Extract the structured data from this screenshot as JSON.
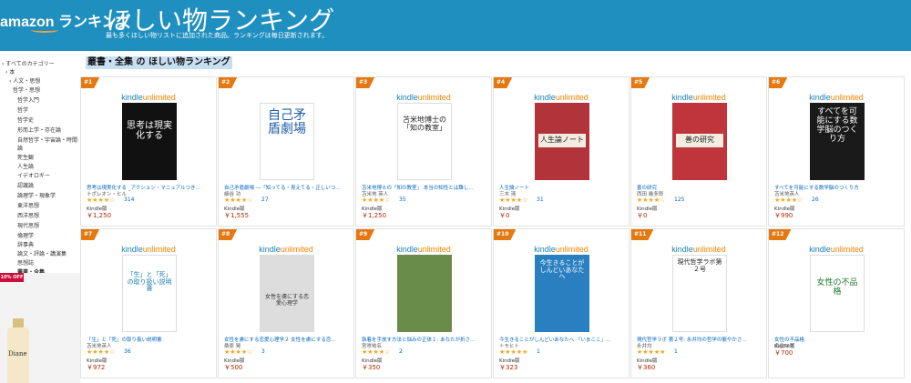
{
  "header": {
    "logo": "amazon ランキング",
    "title": "ほしい物ランキング",
    "subtitle": "最も多くほしい物リストに追加された商品。ランキングは毎日更新されます。"
  },
  "sidebar": {
    "items": [
      "‹ すべてのカテゴリー",
      "‹ 本",
      "‹ 人文・思想",
      "哲学・思想",
      "哲学入門",
      "哲学",
      "哲学史",
      "形而上学・存在論",
      "自然哲学・宇宙論・時間論",
      "死生観",
      "人生論",
      "イデオロギー",
      "認識論",
      "論理学・現象学",
      "東洋思想",
      "西洋思想",
      "現代思想",
      "倫理学",
      "辞事典",
      "論文・評論・講演集",
      "思想誌",
      "叢書・全集"
    ],
    "promo_badge": "10% OFF",
    "promo_label": "Diane"
  },
  "section_title": "叢書・全集 の ほしい物ランキング",
  "kindle_unlimited": {
    "kindle": "kindle",
    "unlimited": "unlimited"
  },
  "colors": {
    "header": "#1f8fbf",
    "rank": "#e47911",
    "star": "#f4a41d",
    "price": "#b12704",
    "link": "#0066c0"
  },
  "products": [
    {
      "rank": "#1",
      "ku": true,
      "cover_text": "思考は現実化する",
      "title": "思考は現実化する _アクション・マニュアルつき…",
      "author": "ナポレオン・ヒル",
      "stars": "★★★★☆",
      "reviews": "314",
      "format": "Kindle版",
      "price": "￥1,250"
    },
    {
      "rank": "#2",
      "ku": false,
      "cover_text": "自己矛盾劇場",
      "title": "自己矛盾劇場 ―「知ってる・見えてる・正しいつ…",
      "author": "細谷 功",
      "stars": "★★★★☆",
      "reviews": "27",
      "format": "Kindle版",
      "price": "￥1,555"
    },
    {
      "rank": "#3",
      "ku": true,
      "cover_text": "苫米地博士の「知の教室」",
      "title": "苫米地博士の「知の教室」 本当の知性とは難し…",
      "author": "苫米地 英人",
      "stars": "★★★★☆",
      "reviews": "35",
      "format": "Kindle版",
      "price": "￥1,250"
    },
    {
      "rank": "#4",
      "ku": true,
      "cover_text": "人生論ノート",
      "title": "人生論ノート",
      "author": "三木 清",
      "stars": "★★★★☆",
      "reviews": "31",
      "format": "Kindle版",
      "price": "￥0"
    },
    {
      "rank": "#5",
      "ku": true,
      "cover_text": "善の研究",
      "title": "善の研究",
      "author": "西田 幾多郎",
      "stars": "★★★★☆",
      "reviews": "125",
      "format": "Kindle版",
      "price": "￥0"
    },
    {
      "rank": "#6",
      "ku": true,
      "cover_text": "すべてを可能にする数学脳のつくり方",
      "title": "すべてを可能にする数学脳のつくり方",
      "author": "苫米地英人",
      "stars": "★★★★☆",
      "reviews": "26",
      "format": "Kindle版",
      "price": "￥990"
    },
    {
      "rank": "#7",
      "ku": true,
      "cover_text": "「生」と「死」の取り扱い説明書",
      "title": "「生」と「死」の取り扱い説明書",
      "author": "苫米地英人",
      "stars": "★★★★☆",
      "reviews": "36",
      "format": "Kindle版",
      "price": "￥972"
    },
    {
      "rank": "#8",
      "ku": true,
      "cover_text": "女性を虜にする恋愛心理学",
      "title": "女性を虜にする恋愛心理学２ 女性を虜にする恋…",
      "author": "桑原 晃",
      "stars": "★★★★☆",
      "reviews": "3",
      "format": "Kindle版",
      "price": "￥500"
    },
    {
      "rank": "#9",
      "ku": true,
      "cover_text": "",
      "title": "執着を手放す方法と悩みの正体１: あなたが折さ…",
      "author": "宮咲祐名",
      "stars": "★★★★☆",
      "reviews": "2",
      "format": "Kindle版",
      "price": "￥350"
    },
    {
      "rank": "#10",
      "ku": true,
      "cover_text": "今生きることがしんどいあなたへ",
      "title": "今生きることがしんどいあなたへ 「いまここ」…",
      "author": "トモヒト",
      "stars": "★★★★★",
      "reviews": "1",
      "format": "Kindle版",
      "price": "￥323"
    },
    {
      "rank": "#11",
      "ku": true,
      "cover_text": "現代哲学ラボ第２号",
      "title": "現代哲学ラボ 第２号: 永井均の哲学の賑やかさ…",
      "author": "永井均",
      "stars": "★★★★★",
      "reviews": "1",
      "format": "Kindle版",
      "price": "￥360"
    },
    {
      "rank": "#12",
      "ku": true,
      "cover_text": "女性の不品格",
      "title": "女性の不品格",
      "author": "名倉マミ",
      "stars": "",
      "reviews": "",
      "format": "Kindle版",
      "price": "￥700"
    }
  ]
}
